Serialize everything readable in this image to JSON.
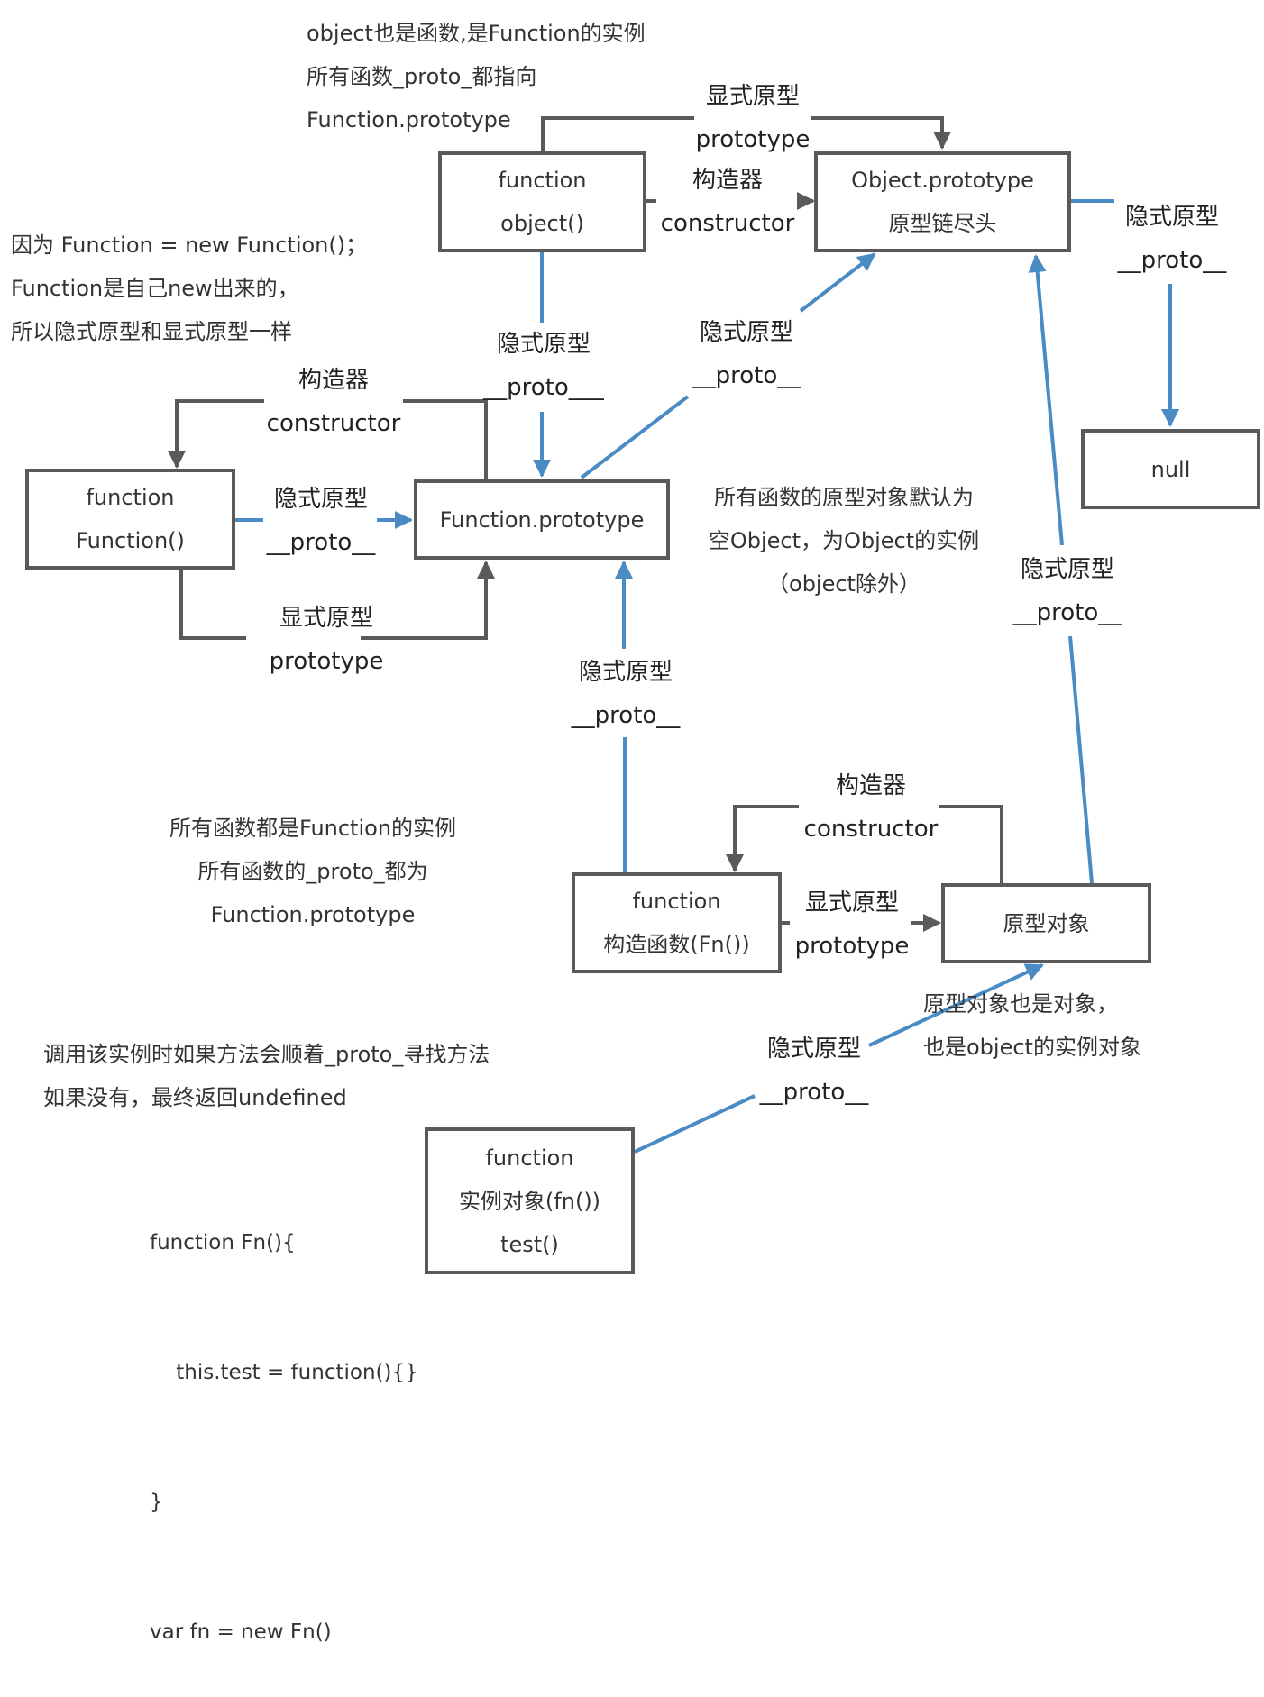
{
  "colors": {
    "explicit_link": "#5a5a5a",
    "implicit_link": "#4a8bc4",
    "node_border": "#5a5a5a",
    "text": "#333333"
  },
  "nodes": {
    "object_fn": {
      "lines": [
        "function",
        "object()"
      ]
    },
    "object_prototype": {
      "lines": [
        "Object.prototype",
        "原型链尽头"
      ]
    },
    "null": {
      "lines": [
        "null"
      ]
    },
    "function_fn": {
      "lines": [
        "function",
        "Function()"
      ]
    },
    "function_prototype": {
      "lines": [
        "Function.prototype"
      ]
    },
    "ctor_fn": {
      "lines": [
        "function",
        "构造函数(Fn())"
      ]
    },
    "proto_object": {
      "lines": [
        "原型对象"
      ]
    },
    "instance": {
      "lines": [
        "function",
        "实例对象(fn())",
        "test()"
      ]
    }
  },
  "edge_labels": {
    "explicit_cn": "显式原型",
    "explicit_en": "prototype",
    "implicit_cn": "隐式原型",
    "implicit_en": "__proto__",
    "implicit_en_alt": "__proto___",
    "ctor_cn": "构造器",
    "ctor_en": "constructor"
  },
  "edges": [
    {
      "id": "object-prototype",
      "from": "object_fn",
      "to": "object_prototype",
      "kind": "explicit",
      "label": [
        "显式原型",
        "prototype"
      ]
    },
    {
      "id": "object-constructor",
      "from": "object_fn",
      "to": "object_prototype",
      "kind": "explicit",
      "label": [
        "构造器",
        "constructor"
      ]
    },
    {
      "id": "object-proto",
      "from": "object_fn",
      "to": "function_prototype",
      "kind": "implicit",
      "label": [
        "隐式原型",
        "__proto___"
      ]
    },
    {
      "id": "objproto-proto",
      "from": "object_prototype",
      "to": "null",
      "kind": "implicit",
      "label": [
        "隐式原型",
        "__proto__"
      ]
    },
    {
      "id": "fnproto-proto",
      "from": "function_prototype",
      "to": "object_prototype",
      "kind": "implicit",
      "label": [
        "隐式原型",
        "__proto__"
      ]
    },
    {
      "id": "function-constructor",
      "from": "function_prototype",
      "to": "function_fn",
      "kind": "explicit",
      "label": [
        "构造器",
        "constructor"
      ]
    },
    {
      "id": "function-proto",
      "from": "function_fn",
      "to": "function_prototype",
      "kind": "implicit",
      "label": [
        "隐式原型",
        "__proto__"
      ]
    },
    {
      "id": "function-prototype",
      "from": "function_fn",
      "to": "function_prototype",
      "kind": "explicit",
      "label": [
        "显式原型",
        "prototype"
      ]
    },
    {
      "id": "ctor-proto",
      "from": "ctor_fn",
      "to": "function_prototype",
      "kind": "implicit",
      "label": [
        "隐式原型",
        "__proto__"
      ]
    },
    {
      "id": "protoobj-proto",
      "from": "proto_object",
      "to": "object_prototype",
      "kind": "implicit",
      "label": [
        "隐式原型",
        "__proto__"
      ]
    },
    {
      "id": "ctor-constructor",
      "from": "proto_object",
      "to": "ctor_fn",
      "kind": "explicit",
      "label": [
        "构造器",
        "constructor"
      ]
    },
    {
      "id": "ctor-prototype",
      "from": "ctor_fn",
      "to": "proto_object",
      "kind": "explicit",
      "label": [
        "显式原型",
        "prototype"
      ]
    },
    {
      "id": "instance-proto",
      "from": "instance",
      "to": "proto_object",
      "kind": "implicit",
      "label": [
        "隐式原型",
        "__proto__"
      ]
    }
  ],
  "notes": {
    "object_is_function": [
      "object也是函数,是Function的实例",
      "所有函数_proto_都指向",
      "Function.prototype"
    ],
    "function_self": [
      "因为 Function = new Function()；",
      "Function是自己new出来的，",
      "所以隐式原型和显式原型一样"
    ],
    "default_prototype": [
      "所有函数的原型对象默认为",
      "空Object，为Object的实例",
      "（object除外）"
    ],
    "all_functions": [
      "所有函数都是Function的实例",
      "所有函数的_proto_都为",
      "Function.prototype"
    ],
    "proto_object_note": [
      "原型对象也是对象，",
      "也是object的实例对象"
    ],
    "lookup": [
      "调用该实例时如果方法会顺着_proto_寻找方法",
      "如果没有，最终返回undefined"
    ]
  },
  "code": [
    "function Fn(){",
    "    this.test = function(){}",
    "}",
    "var fn = new Fn()"
  ]
}
